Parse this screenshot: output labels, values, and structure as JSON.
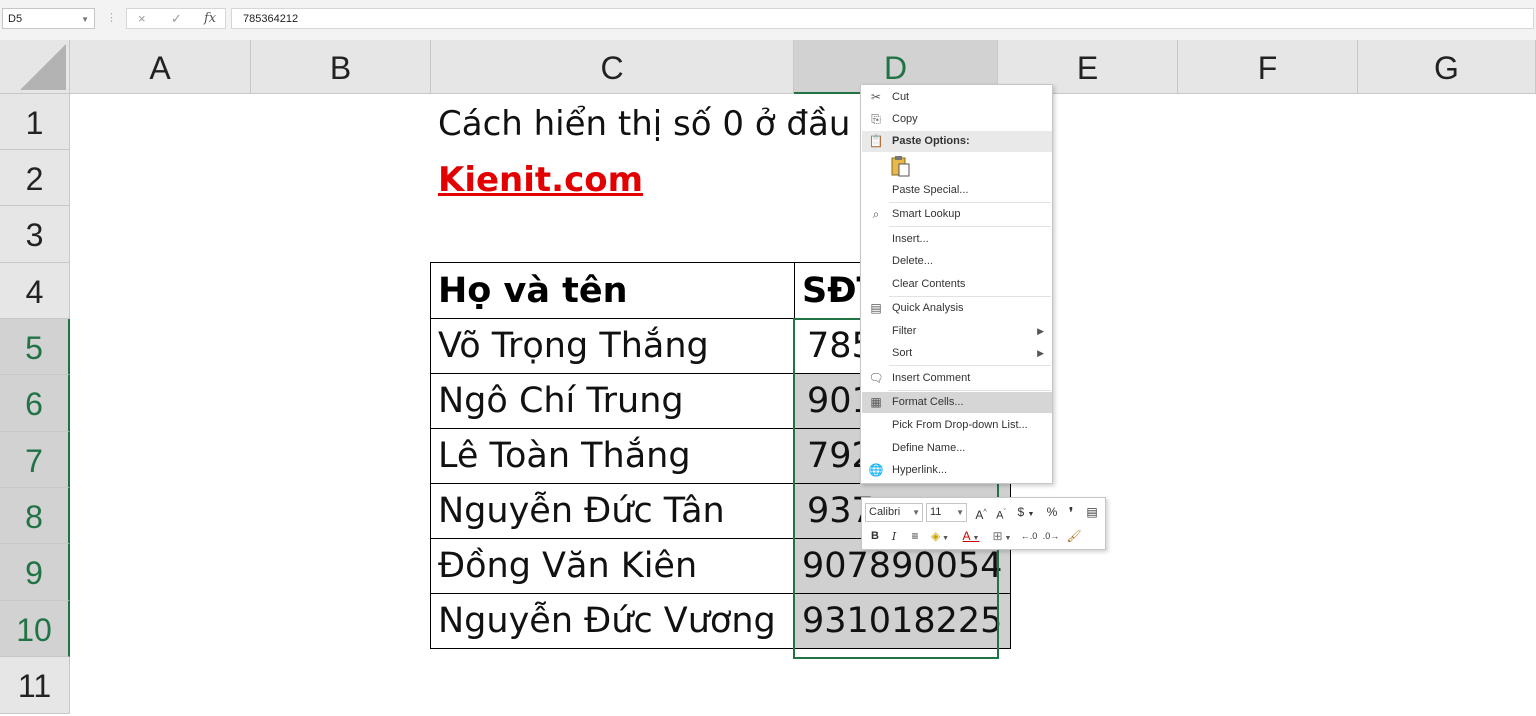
{
  "formula_bar": {
    "name_box": "D5",
    "cancel_icon": "×",
    "enter_icon": "✓",
    "fx_label": "fx",
    "value": "785364212"
  },
  "columns": [
    "A",
    "B",
    "C",
    "D",
    "E",
    "F",
    "G"
  ],
  "selected_column": "D",
  "rows": [
    "1",
    "2",
    "3",
    "4",
    "5",
    "6",
    "7",
    "8",
    "9",
    "10",
    "11"
  ],
  "selected_rows": [
    "5",
    "6",
    "7",
    "8",
    "9",
    "10"
  ],
  "sheet": {
    "title": "Cách hiển thị số 0 ở đầu t",
    "link": "Kienit.com",
    "table": {
      "header_name": "Họ và tên",
      "header_phone": "SĐT",
      "rows": [
        {
          "name": "Võ Trọng Thắng",
          "phone": "785"
        },
        {
          "name": "Ngô Chí Trung",
          "phone": "901"
        },
        {
          "name": "Lê Toàn Thắng",
          "phone": "792"
        },
        {
          "name": "Nguyễn Đức Tân",
          "phone": "937"
        },
        {
          "name": "Đồng Văn Kiên",
          "phone": "907890054"
        },
        {
          "name": "Nguyễn Đức Vương",
          "phone": "931018225"
        }
      ]
    }
  },
  "context_menu": {
    "items": [
      {
        "label": "Cut",
        "icon": "scissors-icon"
      },
      {
        "label": "Copy",
        "icon": "copy-icon"
      },
      {
        "label": "Paste Options:",
        "icon": "paste-icon"
      },
      {
        "label": "Paste Special...",
        "icon": ""
      },
      {
        "label": "Smart Lookup",
        "icon": "search-icon"
      },
      {
        "label": "Insert...",
        "icon": ""
      },
      {
        "label": "Delete...",
        "icon": ""
      },
      {
        "label": "Clear Contents",
        "icon": ""
      },
      {
        "label": "Quick Analysis",
        "icon": "quick-analysis-icon"
      },
      {
        "label": "Filter",
        "icon": ""
      },
      {
        "label": "Sort",
        "icon": ""
      },
      {
        "label": "Insert Comment",
        "icon": "comment-icon"
      },
      {
        "label": "Format Cells...",
        "icon": "format-cells-icon"
      },
      {
        "label": "Pick From Drop-down List...",
        "icon": ""
      },
      {
        "label": "Define Name...",
        "icon": ""
      },
      {
        "label": "Hyperlink...",
        "icon": "hyperlink-icon"
      }
    ]
  },
  "mini_toolbar": {
    "font": "Calibri",
    "size": "11",
    "grow": "A",
    "shrink": "A",
    "currency": "$",
    "percent": "%",
    "comma": "❜",
    "bold": "B",
    "italic": "I",
    "center": "≡",
    "font_color": "A"
  },
  "colors": {
    "accent": "#217346",
    "link": "#e30000",
    "highlight": "#d0d0d0"
  }
}
